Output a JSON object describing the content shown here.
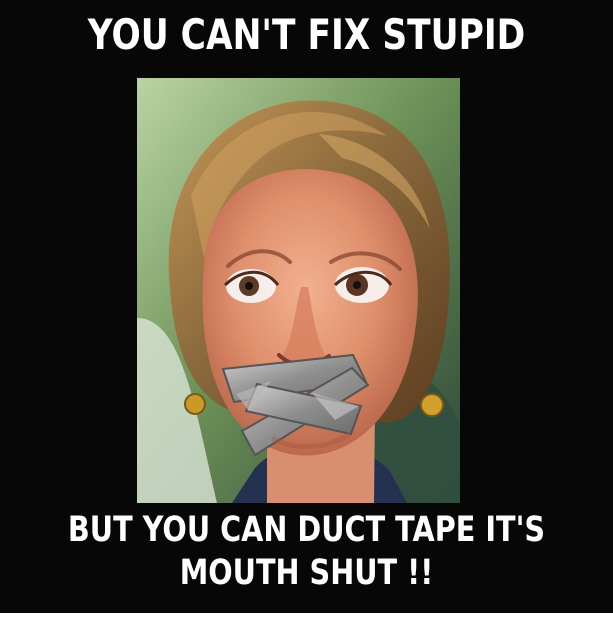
{
  "meme": {
    "top_text": "YOU CAN'T FIX STUPID",
    "bottom_text_line1": "BUT YOU CAN DUCT TAPE IT'S",
    "bottom_text_line2": "MOUTH SHUT  !!"
  },
  "colors": {
    "background": "#070707",
    "text": "#ffffff",
    "tape": "#9b9b9b",
    "hair": "#8b6a3d"
  },
  "image": {
    "subject": "woman-with-duct-tape-over-mouth"
  }
}
